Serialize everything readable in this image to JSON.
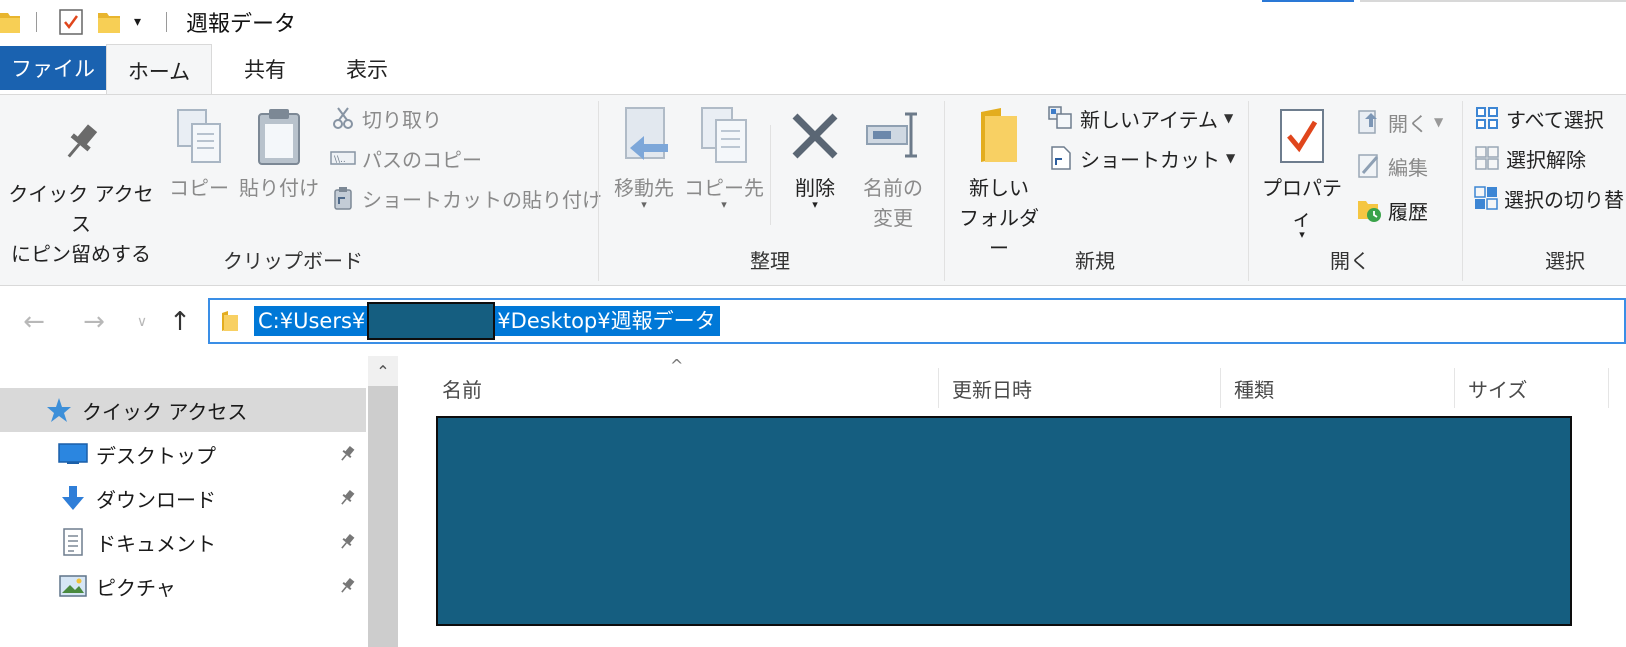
{
  "window": {
    "title": "週報データ"
  },
  "quick_toolbar": {
    "items": [
      "folder-icon",
      "properties-check-icon",
      "new-folder-icon",
      "customize-dropdown-icon"
    ]
  },
  "tabs": [
    {
      "label": "ファイル",
      "active": false
    },
    {
      "label": "ホーム",
      "active": true
    },
    {
      "label": "共有",
      "active": false
    },
    {
      "label": "表示",
      "active": false
    }
  ],
  "ribbon": {
    "clipboard": {
      "label": "クリップボード",
      "pin_line1": "クイック アクセス",
      "pin_line2": "にピン留めする",
      "copy": "コピー",
      "paste": "貼り付け",
      "cut": "切り取り",
      "copy_path": "パスのコピー",
      "paste_shortcut": "ショートカットの貼り付け"
    },
    "organize": {
      "label": "整理",
      "move_to": "移動先",
      "copy_to": "コピー先",
      "delete": "削除",
      "rename_line1": "名前の",
      "rename_line2": "変更"
    },
    "new": {
      "label": "新規",
      "new_folder_line1": "新しい",
      "new_folder_line2": "フォルダー",
      "new_item": "新しいアイテム",
      "shortcut": "ショートカット"
    },
    "open": {
      "label": "開く",
      "properties": "プロパティ",
      "open": "開く",
      "edit": "編集",
      "history": "履歴"
    },
    "select": {
      "label": "選択",
      "select_all": "すべて選択",
      "select_none": "選択解除",
      "invert": "選択の切り替え"
    }
  },
  "address_bar": {
    "path_prefix": "C:¥Users¥",
    "path_suffix": "¥Desktop¥週報データ"
  },
  "nav_pane": {
    "items": [
      {
        "label": "クイック アクセス",
        "icon": "star-icon",
        "selected": true,
        "pinned": false
      },
      {
        "label": "デスクトップ",
        "icon": "desktop-icon",
        "selected": false,
        "pinned": true
      },
      {
        "label": "ダウンロード",
        "icon": "download-arrow-icon",
        "selected": false,
        "pinned": true
      },
      {
        "label": "ドキュメント",
        "icon": "document-icon",
        "selected": false,
        "pinned": true
      },
      {
        "label": "ピクチャ",
        "icon": "picture-icon",
        "selected": false,
        "pinned": true
      }
    ]
  },
  "columns": {
    "name": "名前",
    "modified": "更新日時",
    "type": "種類",
    "size": "サイズ"
  },
  "colors": {
    "accent": "#1a62b0",
    "selection": "#0078d7",
    "redaction": "#155e80"
  }
}
